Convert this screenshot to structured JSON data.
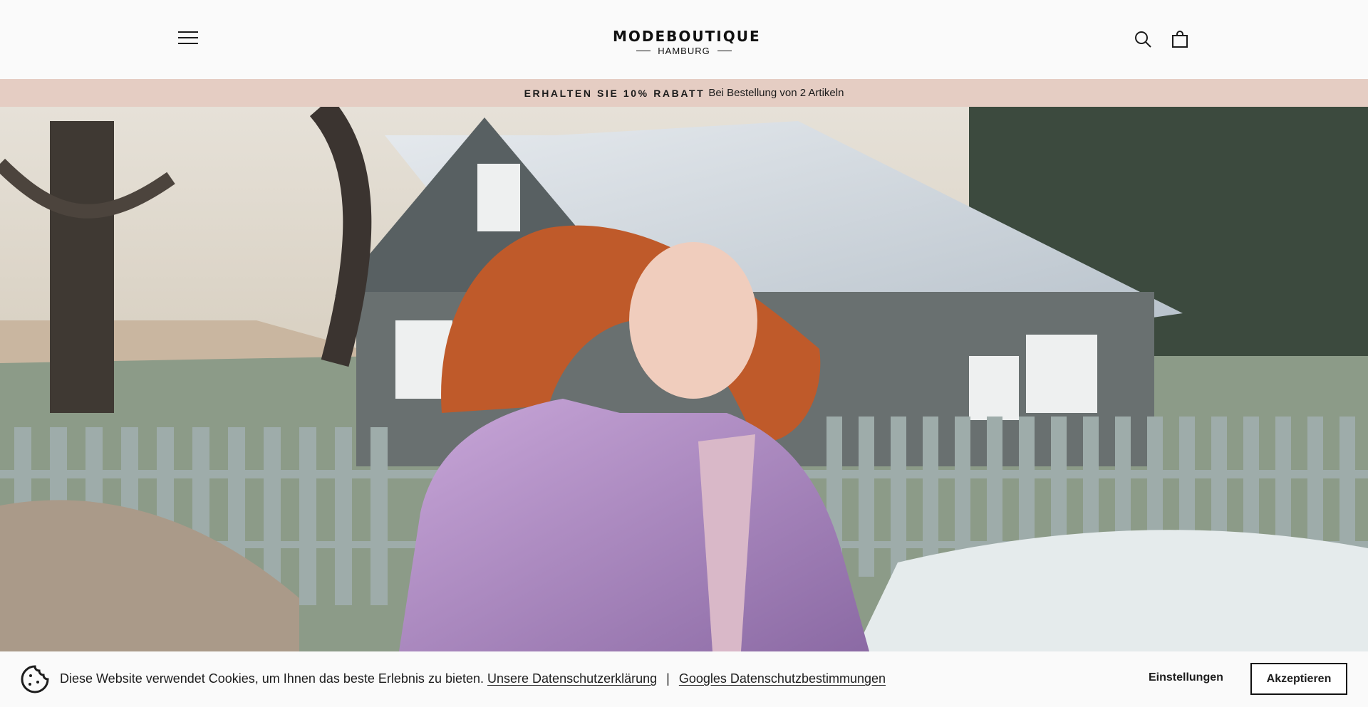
{
  "header": {
    "logo_main": "MODEBOUTIQUE",
    "logo_sub": "HAMBURG"
  },
  "promo": {
    "strong": "ERHALTEN SIE 10% RABATT",
    "text": "Bei Bestellung von 2 Artikeln"
  },
  "cookie": {
    "message": "Diese Website verwendet Cookies, um Ihnen das beste Erlebnis zu bieten.",
    "privacy_link": "Unsere Datenschutzerklärung",
    "separator": "|",
    "google_link": "Googles Datenschutzbestimmungen",
    "settings_label": "Einstellungen",
    "accept_label": "Akzeptieren"
  },
  "icons": {
    "menu": "menu-icon",
    "search": "search-icon",
    "cart": "shopping-bag-icon",
    "cookie": "cookie-icon"
  },
  "colors": {
    "promo_bg": "#e5cdc3",
    "text": "#1b1b1b",
    "page_bg": "#fafafa"
  }
}
